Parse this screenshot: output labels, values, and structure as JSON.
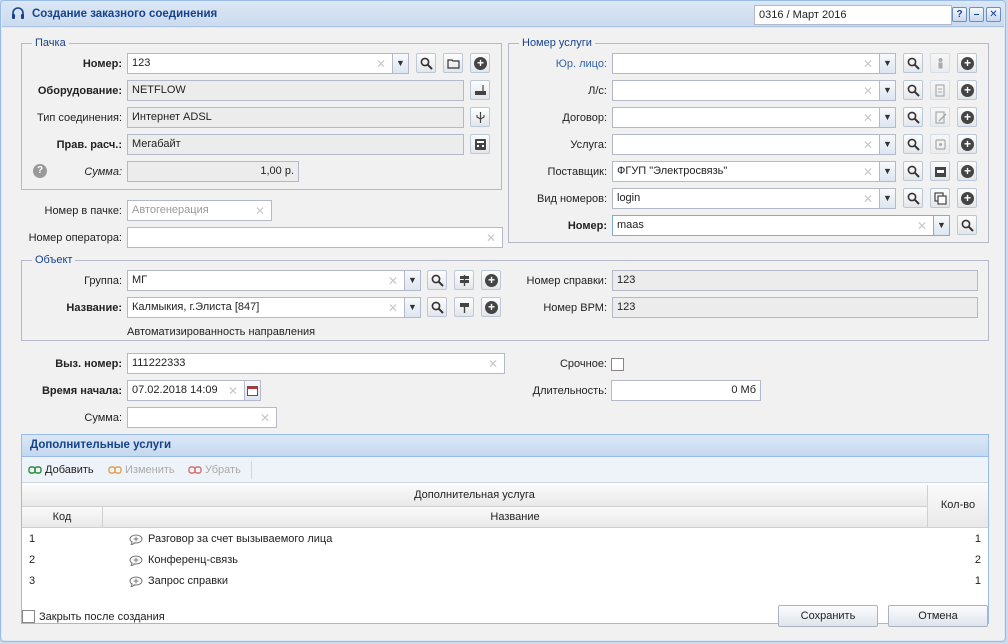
{
  "window": {
    "title": "Создание заказного соединения",
    "period": "0316 / Март 2016"
  },
  "pack": {
    "legend": "Пачка",
    "number_label": "Номер:",
    "number_value": "123",
    "equipment_label": "Оборудование:",
    "equipment_value": "NETFLOW",
    "conn_type_label": "Тип соединения:",
    "conn_type_value": "Интернет ADSL",
    "calc_rule_label": "Прав. расч.:",
    "calc_rule_value": "Мегабайт",
    "sum_label": "Сумма:",
    "sum_value": "1,00 р."
  },
  "misc": {
    "num_in_pack_label": "Номер в пачке:",
    "num_in_pack_placeholder": "Автогенерация",
    "operator_num_label": "Номер оператора:",
    "operator_num_value": ""
  },
  "service": {
    "legend": "Номер услуги",
    "legal_label": "Юр. лицо:",
    "legal_value": "",
    "account_label": "Л/с:",
    "account_value": "",
    "contract_label": "Договор:",
    "contract_value": "",
    "service_label": "Услуга:",
    "service_value": "",
    "supplier_label": "Поставщик:",
    "supplier_value": "ФГУП \"Электросвязь\"",
    "numbers_type_label": "Вид номеров:",
    "numbers_type_value": "login",
    "number_label": "Номер:",
    "number_value": "maas"
  },
  "object": {
    "legend": "Объект",
    "group_label": "Группа:",
    "group_value": "МГ",
    "name_label": "Название:",
    "name_value": "Калмыкия, г.Элиста [847]",
    "auto_note": "Автоматизированность направления",
    "ref_num_label": "Номер справки:",
    "ref_num_value": "123",
    "vrm_num_label": "Номер ВРМ:",
    "vrm_num_value": "123"
  },
  "call": {
    "called_num_label": "Выз. номер:",
    "called_num_value": "111222333",
    "start_label": "Время начала:",
    "start_value": "07.02.2018 14:09",
    "sum_label": "Сумма:",
    "sum_value": "",
    "urgent_label": "Срочное:",
    "duration_label": "Длительность:",
    "duration_value": "0 Мб"
  },
  "extra": {
    "title": "Дополнительные услуги",
    "add_label": "Добавить",
    "edit_label": "Изменить",
    "remove_label": "Убрать",
    "group_header": "Дополнительная услуга",
    "code_header": "Код",
    "name_header": "Название",
    "qty_header": "Кол-во",
    "rows": [
      {
        "code": "1",
        "name": "Разговор за счет вызываемого лица",
        "qty": "1"
      },
      {
        "code": "2",
        "name": "Конференц-связь",
        "qty": "2"
      },
      {
        "code": "3",
        "name": "Запрос справки",
        "qty": "1"
      }
    ]
  },
  "footer": {
    "close_after_label": "Закрыть после создания",
    "save_label": "Сохранить",
    "cancel_label": "Отмена"
  }
}
